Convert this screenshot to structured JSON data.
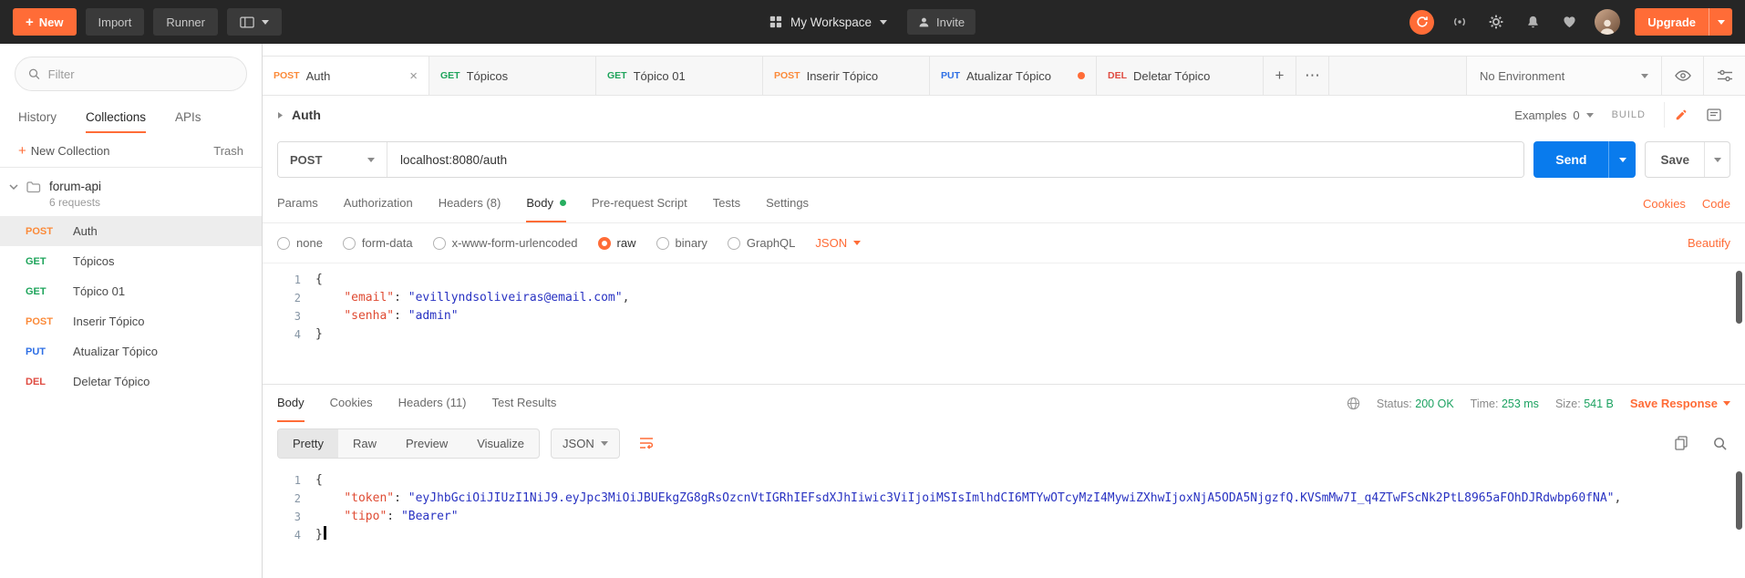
{
  "icons": {
    "plus": "+",
    "close": "×",
    "more": "⋯"
  },
  "header": {
    "new_label": "New",
    "import_label": "Import",
    "runner_label": "Runner",
    "workspace_label": "My Workspace",
    "invite_label": "Invite",
    "upgrade_label": "Upgrade"
  },
  "sidebar": {
    "filter_placeholder": "Filter",
    "tabs": [
      {
        "label": "History"
      },
      {
        "label": "Collections",
        "active": true
      },
      {
        "label": "APIs"
      }
    ],
    "new_collection_label": "New Collection",
    "trash_label": "Trash",
    "collection": {
      "name": "forum-api",
      "meta": "6 requests"
    },
    "requests": [
      {
        "method": "POST",
        "name": "Auth",
        "selected": true
      },
      {
        "method": "GET",
        "name": "Tópicos"
      },
      {
        "method": "GET",
        "name": "Tópico 01"
      },
      {
        "method": "POST",
        "name": "Inserir Tópico"
      },
      {
        "method": "PUT",
        "name": "Atualizar Tópico"
      },
      {
        "method": "DEL",
        "name": "Deletar Tópico"
      }
    ]
  },
  "tabs": {
    "items": [
      {
        "method": "POST",
        "name": "Auth",
        "active": true
      },
      {
        "method": "GET",
        "name": "Tópicos"
      },
      {
        "method": "GET",
        "name": "Tópico 01"
      },
      {
        "method": "POST",
        "name": "Inserir Tópico"
      },
      {
        "method": "PUT",
        "name": "Atualizar Tópico",
        "dirty": true
      },
      {
        "method": "DEL",
        "name": "Deletar Tópico"
      }
    ],
    "environment": "No Environment"
  },
  "request": {
    "breadcrumb": "Auth",
    "examples_label": "Examples",
    "examples_count": "0",
    "build_label": "BUILD",
    "method": "POST",
    "url": "localhost:8080/auth",
    "send_label": "Send",
    "save_label": "Save",
    "tabs": [
      {
        "label": "Params"
      },
      {
        "label": "Authorization"
      },
      {
        "label": "Headers (8)"
      },
      {
        "label": "Body",
        "active": true,
        "dot": true
      },
      {
        "label": "Pre-request Script"
      },
      {
        "label": "Tests"
      },
      {
        "label": "Settings"
      }
    ],
    "cookies_label": "Cookies",
    "code_label": "Code",
    "body_modes": [
      {
        "label": "none"
      },
      {
        "label": "form-data"
      },
      {
        "label": "x-www-form-urlencoded"
      },
      {
        "label": "raw",
        "selected": true
      },
      {
        "label": "binary"
      },
      {
        "label": "GraphQL"
      }
    ],
    "language": "JSON",
    "beautify_label": "Beautify",
    "body_lines": [
      [
        {
          "c": "p",
          "t": "{"
        }
      ],
      [
        {
          "c": "p",
          "t": "    "
        },
        {
          "c": "key",
          "t": "\"email\""
        },
        {
          "c": "p",
          "t": ": "
        },
        {
          "c": "str",
          "t": "\"evillyndsoliveiras@email.com\""
        },
        {
          "c": "p",
          "t": ","
        }
      ],
      [
        {
          "c": "p",
          "t": "    "
        },
        {
          "c": "key",
          "t": "\"senha\""
        },
        {
          "c": "p",
          "t": ": "
        },
        {
          "c": "str",
          "t": "\"admin\""
        }
      ],
      [
        {
          "c": "p",
          "t": "}"
        }
      ]
    ]
  },
  "response": {
    "tabs": [
      {
        "label": "Body",
        "active": true
      },
      {
        "label": "Cookies"
      },
      {
        "label": "Headers (11)"
      },
      {
        "label": "Test Results"
      }
    ],
    "status_label": "Status:",
    "status_value": "200 OK",
    "time_label": "Time:",
    "time_value": "253 ms",
    "size_label": "Size:",
    "size_value": "541 B",
    "save_response_label": "Save Response",
    "views": [
      {
        "label": "Pretty",
        "active": true
      },
      {
        "label": "Raw"
      },
      {
        "label": "Preview"
      },
      {
        "label": "Visualize"
      }
    ],
    "language": "JSON",
    "body_lines": [
      [
        {
          "c": "p",
          "t": "{"
        }
      ],
      [
        {
          "c": "p",
          "t": "    "
        },
        {
          "c": "key",
          "t": "\"token\""
        },
        {
          "c": "p",
          "t": ": "
        },
        {
          "c": "str",
          "t": "\"eyJhbGciOiJIUzI1NiJ9.eyJpc3MiOiJBUEkgZG8gRsOzcnVtIGRhIEFsdXJhIiwic3ViIjoiMSIsImlhdCI6MTYwOTcyMzI4MywiZXhwIjoxNjA5ODA5NjgzfQ.KVSmMw7I_q4ZTwFScNk2PtL8965aFOhDJRdwbp60fNA\""
        },
        {
          "c": "p",
          "t": ","
        }
      ],
      [
        {
          "c": "p",
          "t": "    "
        },
        {
          "c": "key",
          "t": "\"tipo\""
        },
        {
          "c": "p",
          "t": ": "
        },
        {
          "c": "str",
          "t": "\"Bearer\""
        }
      ],
      [
        {
          "c": "p",
          "t": "}"
        }
      ]
    ]
  },
  "colors": {
    "accent": "#FF6C37",
    "send_button": "#097BED",
    "status_green": "#1CA261",
    "body_dot_green": "#27AE60",
    "methods": {
      "GET": "#1EA45B",
      "POST": "#FB8A39",
      "PUT": "#2E6FE5",
      "DEL": "#DF4B41"
    },
    "syntax": {
      "key": "#DF4A32",
      "string": "#2832C2",
      "punctuation": "#3A3A3A"
    },
    "line_number": "#8796A5"
  }
}
